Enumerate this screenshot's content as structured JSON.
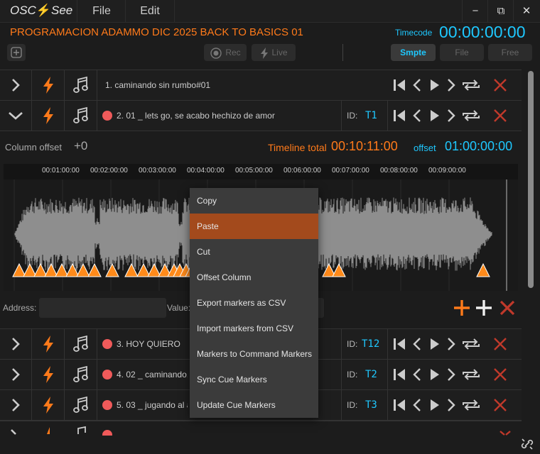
{
  "app": {
    "logo_prefix": "OSC",
    "logo_suffix": "See",
    "menus": [
      "File",
      "Edit"
    ]
  },
  "window": {
    "minimize": "−",
    "restore": "⧉",
    "close": "✕"
  },
  "project": {
    "title": "PROGRAMACION ADAMMO DIC 2025 BACK TO BASICS 01",
    "timecode_label": "Timecode",
    "timecode": "00:00:00:00"
  },
  "toolbar": {
    "add": "+",
    "rec": "Rec",
    "live": "Live",
    "modes": [
      "Smpte",
      "File",
      "Free"
    ]
  },
  "tracks_top": [
    {
      "label": "1.  caminando sin rumbo#01",
      "dot": false,
      "id": "",
      "expanded": false
    },
    {
      "label": "2.  01 _ lets go, se acabo hechizo de amor",
      "dot": true,
      "id": "T1",
      "expanded": true
    }
  ],
  "editor": {
    "column_offset_label": "Column offset",
    "column_offset_value": "+0",
    "timeline_total_label": "Timeline total",
    "timeline_total_value": "00:10:11:00",
    "offset_label": "offset",
    "offset_value": "01:00:00:00",
    "ruler": [
      "00:01:00:00",
      "00:02:00:00",
      "00:03:00:00",
      "00:04:00:00",
      "00:05:00:00",
      "00:06:00:00",
      "00:07:00:00",
      "00:08:00:00",
      "00:09:00:00"
    ],
    "address_label": "Address:",
    "value_label": "Value:"
  },
  "context_menu": {
    "items": [
      "Copy",
      "Paste",
      "Cut",
      "Offset Column",
      "Export markers as CSV",
      "Import markers from CSV",
      "Markers to Command Markers",
      "Sync Cue Markers",
      "Update Cue Markers"
    ],
    "selected": "Paste"
  },
  "tracks_bottom": [
    {
      "label": "3.  HOY QUIERO",
      "dot": true,
      "id_label": "ID:",
      "id": "T12"
    },
    {
      "label": "4.  02 _ caminando,",
      "dot": true,
      "id_label": "ID:",
      "id": "T2"
    },
    {
      "label": "5.  03 _ jugando al a",
      "dot": true,
      "id_label": "ID:",
      "id": "T3"
    }
  ],
  "id_label": "ID:",
  "colors": {
    "accent_orange": "#ff7a1a",
    "accent_cyan": "#1ec8ff",
    "delete_red": "#c0392b",
    "menu_selected": "#a34a1c"
  }
}
